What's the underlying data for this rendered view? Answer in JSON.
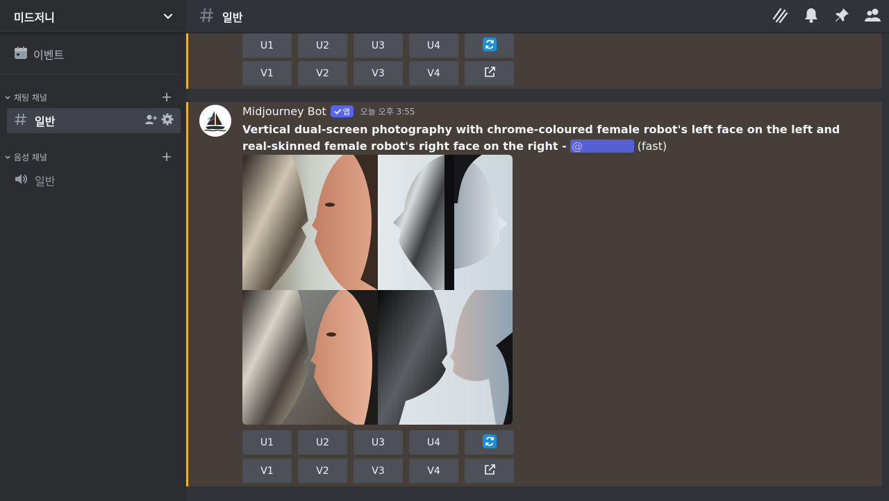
{
  "sidebar": {
    "server_name": "미드저니",
    "events_label": "이벤트",
    "text_category": "채팅 채널",
    "text_channel": "일반",
    "voice_category": "음성 채널",
    "voice_channel": "일반"
  },
  "topbar": {
    "channel_title": "일반",
    "icons": [
      "threads-icon",
      "bell-icon",
      "pin-icon",
      "members-icon"
    ]
  },
  "message_prev": {
    "upscale": [
      "U1",
      "U2",
      "U3",
      "U4"
    ],
    "variation": [
      "V1",
      "V2",
      "V3",
      "V4"
    ]
  },
  "message": {
    "author": "Midjourney Bot",
    "badge": "앱",
    "timestamp": "오늘 오후 3:55",
    "prompt": "Vertical dual-screen photography with chrome-coloured female robot's left face on the left and real-skinned female robot's right face on the right",
    "separator": " - ",
    "mention": "@              ",
    "mode": "(fast)",
    "upscale": [
      "U1",
      "U2",
      "U3",
      "U4"
    ],
    "variation": [
      "V1",
      "V2",
      "V3",
      "V4"
    ]
  },
  "colors": {
    "accent": "#f0b232",
    "button": "#4e5058",
    "highlight_bg": "#463f39",
    "bot_badge": "#5865f2",
    "refresh_icon": "#1a8fd8"
  }
}
